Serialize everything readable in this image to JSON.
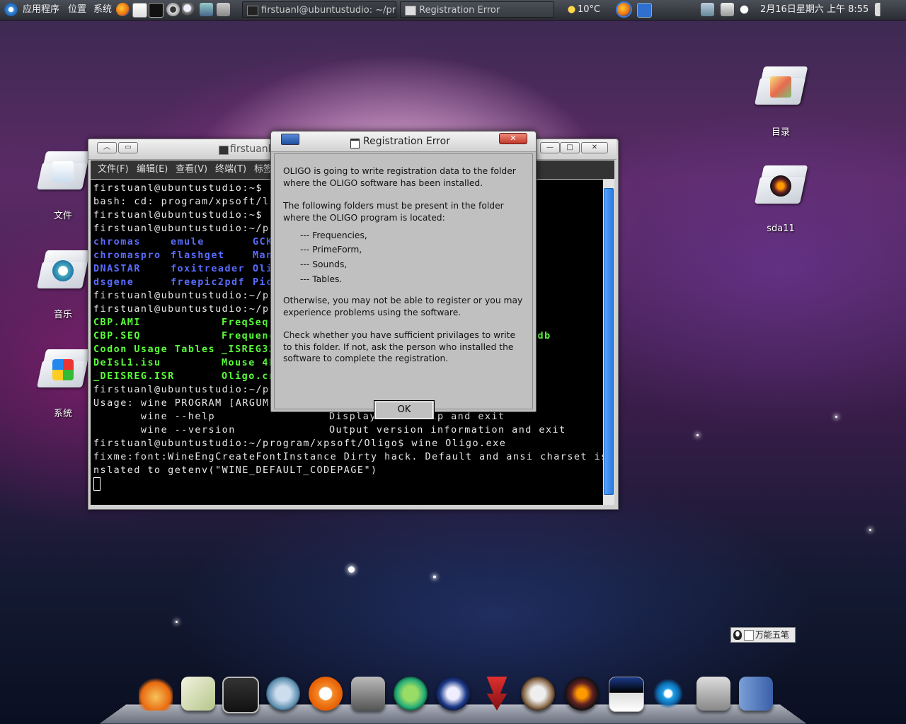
{
  "top_panel": {
    "menus": [
      "应用程序",
      "位置",
      "系统"
    ],
    "tasks": [
      {
        "label": "firstuanl@ubuntustudio: ~/pr..."
      },
      {
        "label": "Registration Error"
      }
    ],
    "weather": "10°C",
    "datetime": "2月16日星期六 上午 8:55"
  },
  "desktop_icons": [
    {
      "label": "文件"
    },
    {
      "label": "音乐"
    },
    {
      "label": "系统"
    },
    {
      "label": "目录"
    },
    {
      "label": "sda11"
    }
  ],
  "terminal": {
    "title": "firstuanl@ubuntustudio: ~/program/xpsoft/Oligo",
    "menu": [
      "文件(F)",
      "编辑(E)",
      "查看(V)",
      "终端(T)",
      "标签"
    ],
    "lines": [
      "firstuanl@ubuntustudio:~$ cd",
      "bash: cd: program/xpsoft/ls:",
      "firstuanl@ubuntustudio:~$ cd",
      "firstuanl@ubuntustudio:~/pro",
      "firstuanl@ubuntustudio:~/pro",
      "firstuanl@ubuntustudio:~/pro",
      "firstuanl@ubuntustudio:~/pro",
      "Usage: wine PROGRAM [ARGUMEN",
      "       wine --help",
      "       wine --version",
      "firstuanl@ubuntustudio:~/program/xpsoft/Oligo$ wine Oligo.exe",
      "fixme:font:WineEngCreateFontInstance Dirty hack. Default and ansi charset is tra",
      "nslated to getenv(\"WINE_DEFAULT_CODEPAGE\")"
    ],
    "ls_dirs": [
      [
        "chromas",
        "emule",
        "GCK"
      ],
      [
        "chromaspro",
        "flashget",
        "Man"
      ],
      [
        "DNASTAR",
        "foxitreader",
        "Oli"
      ],
      [
        "dsgene",
        "freepic2pdf",
        "Pic"
      ]
    ],
    "ls_files": [
      [
        "CBP.AMI",
        "FreqSeq"
      ],
      [
        "CBP.SEQ",
        "Frequenc",
        "odb"
      ],
      [
        "Codon Usage Tables",
        "_ISREG32"
      ],
      [
        "DeIsL1.isu",
        "Mouse 4E"
      ],
      [
        "_DEISREG.ISR",
        "Oligo.cn"
      ]
    ],
    "help_desc": [
      "Display this help and exit",
      "Output version information and exit"
    ]
  },
  "dialog": {
    "title": "Registration Error",
    "para1": "OLIGO is going to write registration data to the folder where the OLIGO software has been installed.",
    "para2": "The following folders must be present in the folder where the OLIGO program is located:",
    "folders": [
      "--- Frequencies,",
      "--- PrimeForm,",
      "--- Sounds,",
      "--- Tables."
    ],
    "para3": "Otherwise, you may not be able to register or you may experience problems using the software.",
    "para4": "Check whether you have sufficient privilages to write to this folder. If not, ask the person who installed the software to complete the registration.",
    "ok_label": "OK"
  },
  "ime": {
    "label": "万能五笔"
  }
}
